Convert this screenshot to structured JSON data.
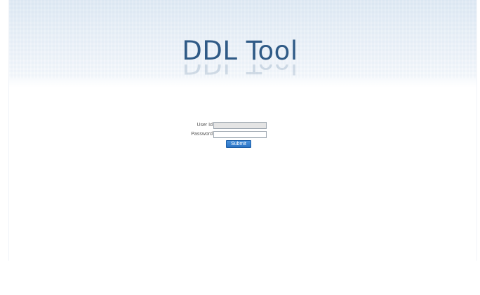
{
  "header": {
    "title": "DDL Tool"
  },
  "login_form": {
    "userid_label": "User Id",
    "userid_value": "",
    "password_label": "Password",
    "password_value": "",
    "submit_label": "Submit"
  },
  "colors": {
    "title": "#2f5a86",
    "button": "#2a73c4"
  }
}
